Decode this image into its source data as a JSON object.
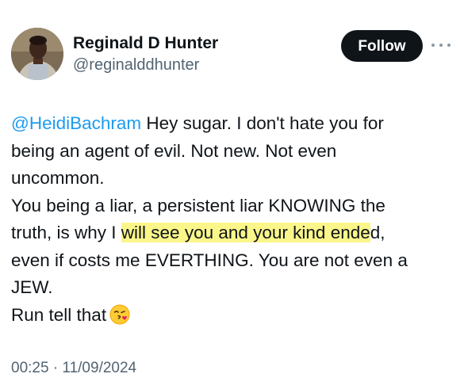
{
  "user": {
    "display_name": "Reginald D Hunter",
    "handle": "@reginalddhunter"
  },
  "actions": {
    "follow_label": "Follow",
    "more_icon": "more-horizontal-icon"
  },
  "tweet": {
    "mention": "@HeidiBachram",
    "line1_rest": " Hey sugar. I don't hate you for",
    "line2": "being an agent of evil. Not new. Not even",
    "line3": "uncommon.",
    "line4": "You being a liar, a persistent liar KNOWING the",
    "line5_before": "truth, is why I ",
    "line5_highlight": "will see you and your kind ende",
    "line5_after": "d,",
    "line6": "even if costs me EVERTHING.  You are not even a",
    "line7": "JEW.",
    "line8": "Run tell that",
    "emoji": "kissing-face-with-heart-emoji",
    "highlight_color": "#fbf68a"
  },
  "meta": {
    "timestamp": "00:25 · 11/09/2024"
  },
  "colors": {
    "text": "#0f1419",
    "secondary": "#536471",
    "link": "#1d9bf0",
    "button_bg": "#0f1419",
    "button_text": "#ffffff"
  }
}
